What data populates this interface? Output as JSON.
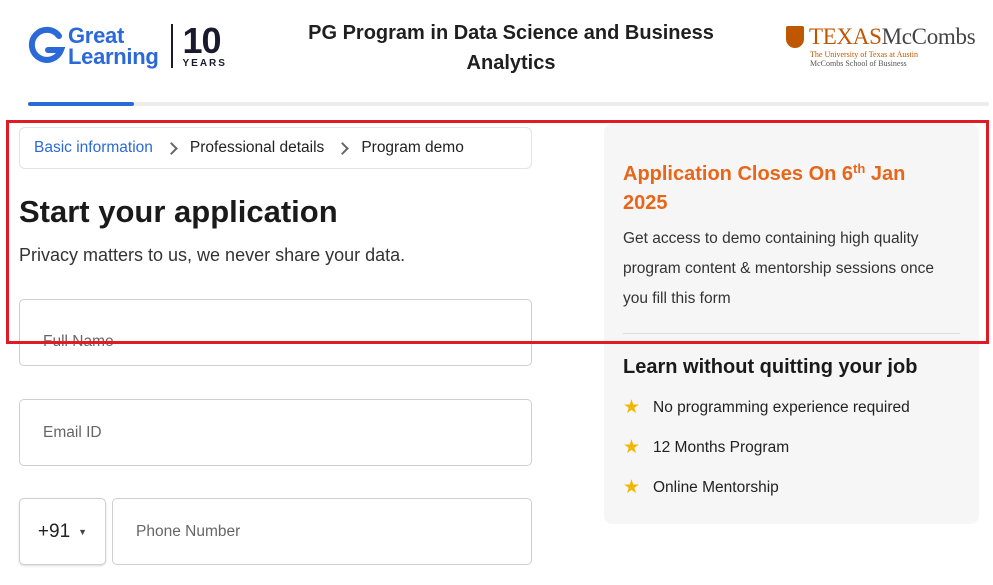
{
  "header": {
    "brand_line1": "Great",
    "brand_line2": "Learning",
    "anniversary_number": "10",
    "anniversary_label": "YEARS",
    "program_title": "PG Program in Data Science and Business Analytics",
    "partner_name": "TEXAS",
    "partner_name_suffix": "McCombs",
    "partner_sub1": "The University of Texas at Austin",
    "partner_sub2": "McCombs School of Business",
    "progress_fraction": 0.11
  },
  "steps": [
    {
      "label": "Basic information",
      "active": true
    },
    {
      "label": "Professional details",
      "active": false
    },
    {
      "label": "Program demo",
      "active": false
    }
  ],
  "form": {
    "heading": "Start your application",
    "subheading": "Privacy matters to us, we never share your data.",
    "full_name_placeholder": "Full Name",
    "email_placeholder": "Email ID",
    "country_code": "+91",
    "phone_placeholder": "Phone Number"
  },
  "info_card": {
    "closes_prefix": "Application Closes On 6",
    "closes_sup": "th",
    "closes_suffix": " Jan 2025",
    "description": "Get access to demo containing high quality program content & mentorship sessions once you fill this form",
    "features_heading": "Learn without quitting your job",
    "features": [
      "No programming experience required",
      "12 Months Program",
      "Online Mentorship"
    ]
  },
  "colors": {
    "brand_blue": "#2b6ad6",
    "accent_orange": "#e8661a",
    "star_yellow": "#f2b705",
    "highlight_red": "#e01b24"
  }
}
